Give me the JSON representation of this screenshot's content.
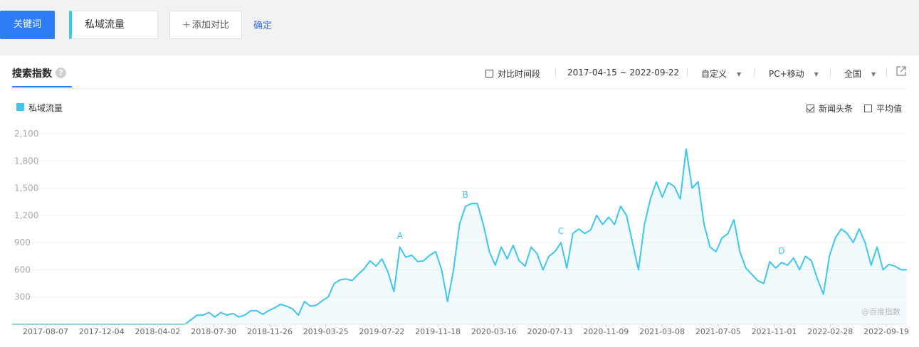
{
  "toolbar": {
    "keyword_button": "关键词",
    "keyword_value": "私域流量",
    "add_compare": "添加对比",
    "confirm": "确定"
  },
  "panel": {
    "title": "搜索指数",
    "help": "?",
    "compare_period": "对比时间段",
    "date_range": "2017-04-15 ~ 2022-09-22",
    "custom": "自定义",
    "device": "PC+移动",
    "region": "全国"
  },
  "legend": {
    "series_name": "私域流量",
    "color": "#3ec6ef"
  },
  "options": {
    "news_headlines": "新闻头条",
    "news_checked": true,
    "average": "平均值",
    "average_checked": false
  },
  "watermark": "@百度指数",
  "chart_data": {
    "type": "area",
    "y_ticks": [
      "2,100",
      "1,800",
      "1,500",
      "1,200",
      "900",
      "600",
      "300"
    ],
    "ylim": [
      0,
      2100
    ],
    "x_ticks": [
      "2017-08-07",
      "2017-12-04",
      "2018-04-02",
      "2018-07-30",
      "2018-11-26",
      "2019-03-25",
      "2019-07-22",
      "2019-11-18",
      "2020-03-16",
      "2020-07-13",
      "2020-11-09",
      "2021-03-08",
      "2021-07-05",
      "2021-11-01",
      "2022-02-28",
      "2022-09-19"
    ],
    "annotations": [
      {
        "label": "A",
        "index": 65
      },
      {
        "label": "B",
        "index": 76
      },
      {
        "label": "C",
        "index": 92
      },
      {
        "label": "D",
        "index": 129
      }
    ],
    "series": [
      {
        "name": "私域流量",
        "color": "#3ec6ef",
        "values": [
          0,
          0,
          0,
          0,
          0,
          0,
          0,
          0,
          0,
          0,
          0,
          0,
          0,
          0,
          0,
          0,
          0,
          0,
          0,
          0,
          0,
          0,
          0,
          0,
          0,
          0,
          0,
          0,
          0,
          0,
          50,
          100,
          100,
          130,
          80,
          130,
          100,
          120,
          80,
          100,
          150,
          150,
          110,
          150,
          180,
          220,
          200,
          170,
          100,
          250,
          200,
          210,
          260,
          300,
          450,
          490,
          500,
          480,
          550,
          610,
          700,
          640,
          720,
          580,
          360,
          850,
          740,
          760,
          690,
          700,
          760,
          800,
          600,
          250,
          600,
          1100,
          1300,
          1330,
          1330,
          1100,
          800,
          650,
          850,
          720,
          870,
          700,
          640,
          850,
          780,
          600,
          750,
          800,
          900,
          620,
          1000,
          1050,
          1000,
          1040,
          1200,
          1100,
          1180,
          1100,
          1300,
          1200,
          900,
          600,
          1100,
          1380,
          1570,
          1400,
          1560,
          1520,
          1380,
          1930,
          1500,
          1570,
          1100,
          850,
          800,
          950,
          1000,
          1150,
          800,
          620,
          550,
          480,
          450,
          690,
          620,
          680,
          650,
          730,
          600,
          750,
          700,
          500,
          330,
          750,
          950,
          1050,
          1000,
          900,
          1050,
          900,
          650,
          850,
          600,
          660,
          640,
          600,
          600
        ]
      }
    ]
  }
}
